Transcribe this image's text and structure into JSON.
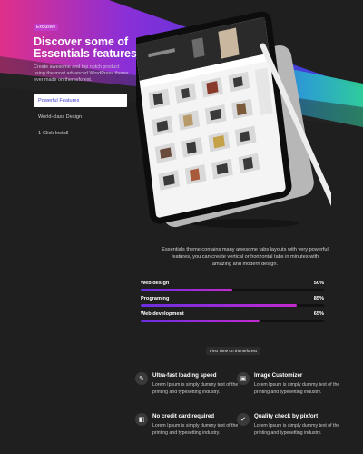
{
  "hero": {
    "badge": "Exclusive",
    "title": "Discover some of Essentials features.",
    "description": "Create awesome and top notch product using the most advanced WordPress theme ever made on themeforest."
  },
  "tabs": [
    {
      "label": "Powerful Features",
      "active": true
    },
    {
      "label": "World-class Design",
      "active": false
    },
    {
      "label": "1-Click Install",
      "active": false
    }
  ],
  "description": "Essentials theme contains many awesome tabs layouts with very powerful features, you can create vertical or horizontal tabs in minutes with amazing and modern design.",
  "skills": [
    {
      "label": "Web design",
      "percent": 50,
      "display": "50%"
    },
    {
      "label": "Programing",
      "percent": 85,
      "display": "85%"
    },
    {
      "label": "Web development",
      "percent": 65,
      "display": "65%"
    }
  ],
  "pill": "First Time on themeforest",
  "features": [
    {
      "title": "Ultra-fast loading speed",
      "text": "Lorem Ipsum is simply dummy text of the printing and typesetting industry.",
      "icon": "rocket-icon",
      "glyph": "✎"
    },
    {
      "title": "Image Customizer",
      "text": "Lorem Ipsum is simply dummy text of the printing and typesetting industry.",
      "icon": "image-icon",
      "glyph": "▣"
    },
    {
      "title": "No credit card required",
      "text": "Lorem Ipsum is simply dummy text of the printing and typesetting industry.",
      "icon": "card-icon",
      "glyph": "◧"
    },
    {
      "title": "Quality check by pixfort",
      "text": "Lorem Ipsum is simply dummy text of the printing and typesetting industry.",
      "icon": "check-icon",
      "glyph": "✔"
    }
  ],
  "colors": {
    "accent": "#c03cc9",
    "tab_active_text": "#3f3fd0",
    "bar_start": "#6a2ee0",
    "bar_end": "#c52ad0",
    "background": "#1f1f1f"
  }
}
